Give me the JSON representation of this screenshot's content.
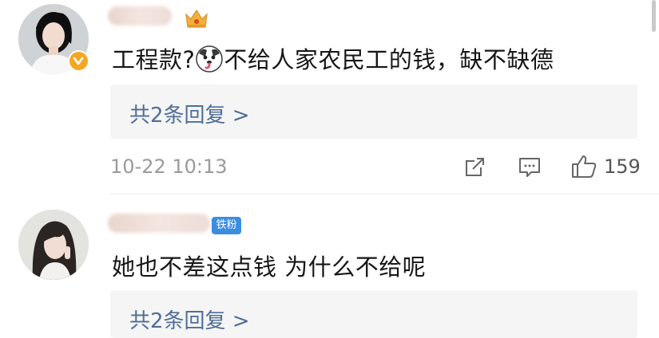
{
  "comments": [
    {
      "text_before": "工程款?",
      "emoji": "dog-face-emoji",
      "text_after": "不给人家农民工的钱，缺不缺德",
      "reply_link": "共2条回复 >",
      "timestamp": "10-22 10:13",
      "like_count": "159",
      "badge": "crown-icon"
    },
    {
      "text": "她也不差这点钱 为什么不给呢",
      "fan_badge": "铁粉",
      "reply_link": "共2条回复 >"
    }
  ],
  "colors": {
    "link": "#4f6e98",
    "reply_bg": "#f5f5f5",
    "verified_badge": "#f5a623",
    "fan_badge": "#3b8de0",
    "meta_text": "#9a9a9a"
  },
  "icons": [
    "share-icon",
    "comment-icon",
    "thumbs-up-icon",
    "verified-badge-icon",
    "crown-icon"
  ]
}
